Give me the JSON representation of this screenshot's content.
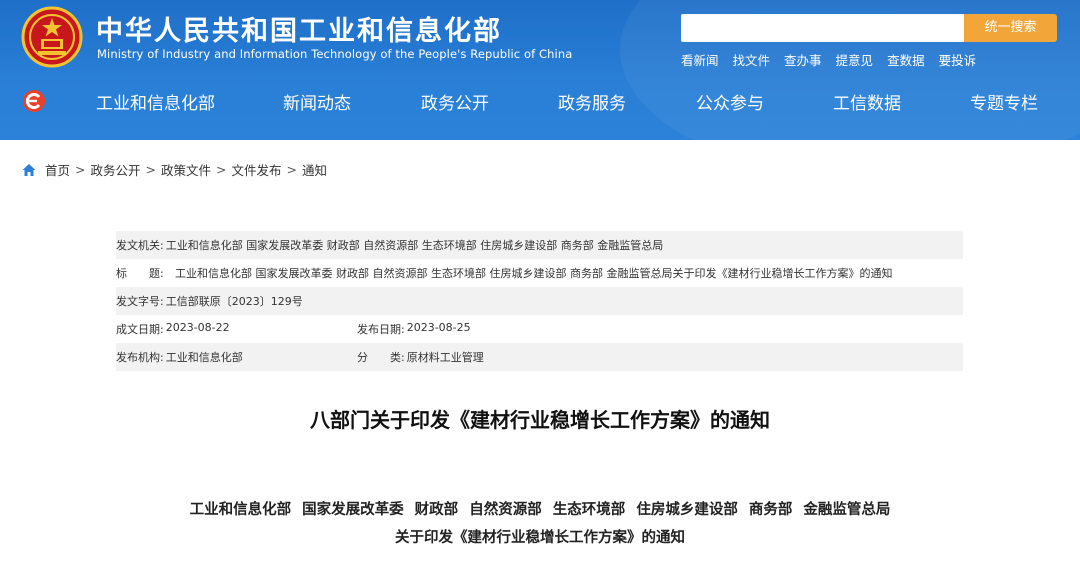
{
  "header": {
    "site_name_cn": "中华人民共和国工业和信息化部",
    "site_name_en": "Ministry of Industry and Information Technology of the People's Republic of China",
    "search": {
      "placeholder": "",
      "button_label": "统一搜索"
    },
    "quick_links": [
      "看新闻",
      "找文件",
      "查办事",
      "提意见",
      "查数据",
      "要投诉"
    ],
    "colors": {
      "header_blue": "#2a7fd6",
      "search_button": "#f2a63a"
    }
  },
  "nav": {
    "items": [
      "工业和信息化部",
      "新闻动态",
      "政务公开",
      "政务服务",
      "公众参与",
      "工信数据",
      "专题专栏"
    ]
  },
  "breadcrumb": [
    "首页",
    "政务公开",
    "政策文件",
    "文件发布",
    "通知"
  ],
  "meta": {
    "issuer_label": "发文机关:",
    "issuer_value": "工业和信息化部 国家发展改革委 财政部 自然资源部 生态环境部 住房城乡建设部 商务部 金融监管总局",
    "title_label": "标　　题:",
    "title_value": "工业和信息化部 国家发展改革委 财政部 自然资源部 生态环境部 住房城乡建设部 商务部 金融监管总局关于印发《建材行业稳增长工作方案》的通知",
    "doc_no_label": "发文字号:",
    "doc_no_value": "工信部联原〔2023〕129号",
    "created_label": "成文日期:",
    "created_value": "2023-08-22",
    "published_label": "发布日期:",
    "published_value": "2023-08-25",
    "org_label": "发布机构:",
    "org_value": "工业和信息化部",
    "category_label": "分　　类:",
    "category_value": "原材料工业管理"
  },
  "article": {
    "title": "八部门关于印发《建材行业稳增长工作方案》的通知",
    "issuers": "工业和信息化部 国家发展改革委 财政部 自然资源部 生态环境部 住房城乡建设部 商务部 金融监管总局",
    "subtitle": "关于印发《建材行业稳增长工作方案》的通知"
  }
}
